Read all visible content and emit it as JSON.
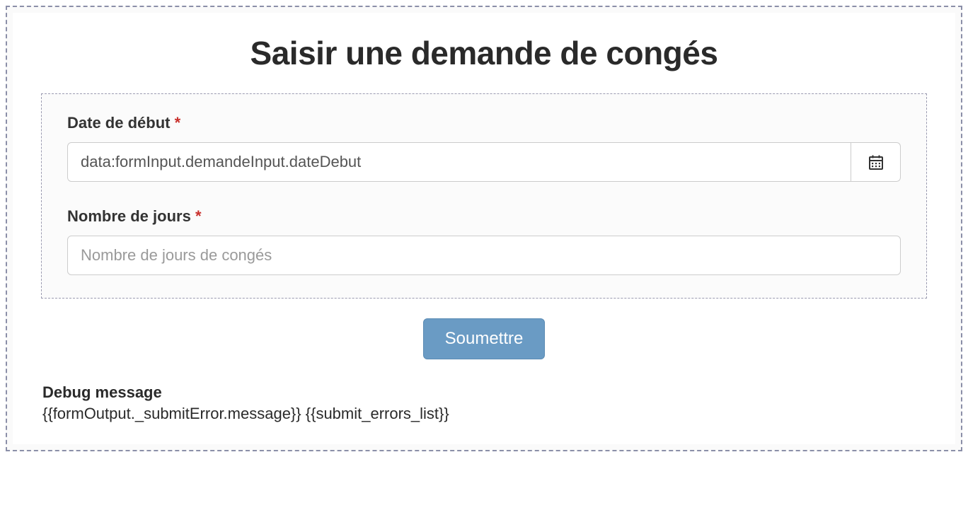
{
  "page": {
    "title": "Saisir une demande de congés"
  },
  "form": {
    "dateDebut": {
      "label": "Date de début",
      "required_marker": "*",
      "value": "data:formInput.demandeInput.dateDebut"
    },
    "nombreJours": {
      "label": "Nombre de jours",
      "required_marker": "*",
      "placeholder": "Nombre de jours de congés",
      "value": ""
    },
    "submit_label": "Soumettre"
  },
  "debug": {
    "label": "Debug message",
    "body": "{{formOutput._submitError.message}} {{submit_errors_list}}"
  }
}
